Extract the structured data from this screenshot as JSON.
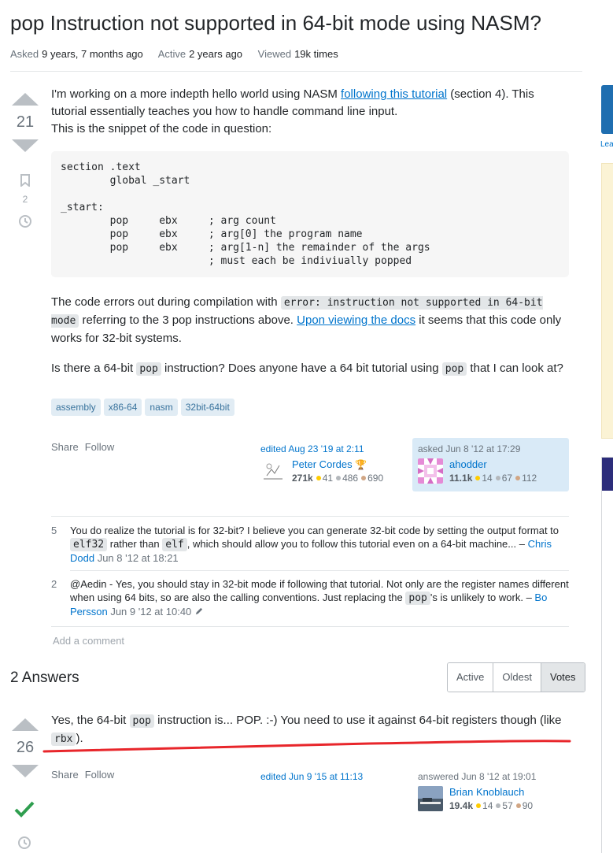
{
  "question": {
    "title": "pop Instruction not supported in 64-bit mode using NASM?",
    "meta": {
      "asked_label": "Asked",
      "asked_value": "9 years, 7 months ago",
      "active_label": "Active",
      "active_value": "2 years ago",
      "viewed_label": "Viewed",
      "viewed_value": "19k times"
    },
    "votes": "21",
    "bookmarks": "2",
    "body": {
      "p1_a": "I'm working on a more indepth hello world using NASM ",
      "p1_link": "following this tutorial",
      "p1_b": " (section 4). This tutorial essentially teaches you how to handle command line input.",
      "p1_c": "This is the snippet of the code in question:",
      "code": "section .text\n        global _start\n\n_start:\n        pop     ebx     ; arg count\n        pop     ebx     ; arg[0] the program name\n        pop     ebx     ; arg[1-n] the remainder of the args\n                        ; must each be indiviually popped",
      "p2_a": "The code errors out during compilation with ",
      "p2_code": "error: instruction not supported in 64-bit mode",
      "p2_b": " referring to the 3 pop instructions above. ",
      "p2_link": "Upon viewing the docs",
      "p2_c": " it seems that this code only works for 32-bit systems.",
      "p3_a": "Is there a 64-bit ",
      "p3_code1": "pop",
      "p3_b": " instruction? Does anyone have a 64 bit tutorial using ",
      "p3_code2": "pop",
      "p3_c": " that I can look at?"
    },
    "tags": [
      "assembly",
      "x86-64",
      "nasm",
      "32bit-64bit"
    ],
    "menu": {
      "share": "Share",
      "follow": "Follow"
    },
    "editor": {
      "when": "edited Aug 23 '19 at 2:11",
      "name": "Peter Cordes",
      "rep": "271k",
      "gold": "41",
      "silver": "486",
      "bronze": "690"
    },
    "asker": {
      "when": "asked Jun 8 '12 at 17:29",
      "name": "ahodder",
      "rep": "11.1k",
      "gold": "14",
      "silver": "67",
      "bronze": "112"
    },
    "comments": [
      {
        "score": "5",
        "text_a": "You do realize the tutorial is for 32-bit? I believe you can generate 32-bit code by setting the output format to ",
        "code1": "elf32",
        "text_b": " rather than ",
        "code2": "elf",
        "text_c": ", which should allow you to follow this tutorial even on a 64-bit machine...",
        "dash": "–",
        "user": "Chris Dodd",
        "date": "Jun 8 '12 at 18:21"
      },
      {
        "score": "2",
        "text_a": "@Aedin - Yes, you should stay in 32-bit mode if following that tutorial. Not only are the register names different when using 64 bits, so are also the calling conventions. Just replacing the ",
        "code1": "pop",
        "text_b": "'s is unlikely to work.",
        "dash": "–",
        "user": "Bo Persson",
        "date": "Jun 9 '12 at 10:40"
      }
    ],
    "add_comment": "Add a comment"
  },
  "answers_header": {
    "count_label": "2 Answers",
    "sort": [
      "Active",
      "Oldest",
      "Votes"
    ],
    "active_sort": "Votes"
  },
  "answer": {
    "votes": "26",
    "body_a": "Yes, the 64-bit ",
    "code1": "pop",
    "body_b": " instruction is... POP. :-) You need to use it against 64-bit registers though (like ",
    "code2": "rbx",
    "body_c": ").",
    "menu": {
      "share": "Share",
      "follow": "Follow"
    },
    "edited": "edited Jun 9 '15 at 11:13",
    "answerer": {
      "when": "answered Jun 8 '12 at 19:01",
      "name": "Brian Knoblauch",
      "rep": "19.4k",
      "gold": "14",
      "silver": "57",
      "bronze": "90"
    }
  },
  "sidebar": {
    "partial_link": "Lea"
  },
  "colors": {
    "link": "#0074cc",
    "tag_bg": "#e1ecf4",
    "tag_fg": "#39739d",
    "accepted": "#2f9e4f",
    "annotation": "#e8262b"
  }
}
